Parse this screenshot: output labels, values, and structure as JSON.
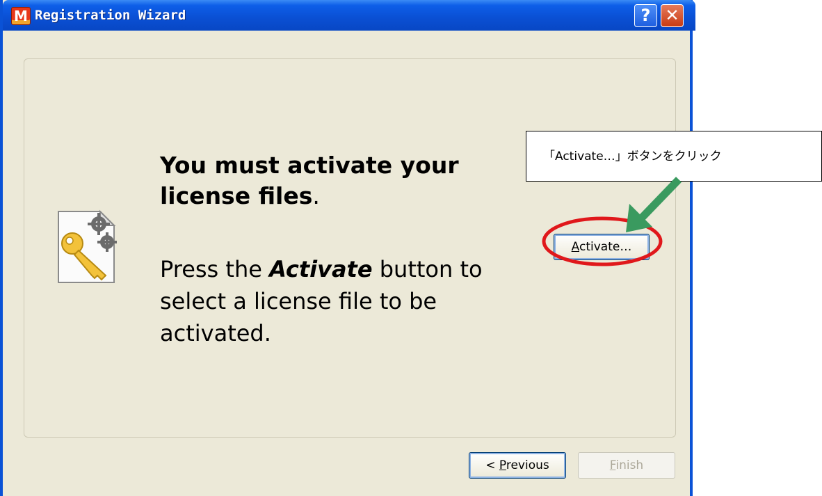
{
  "window": {
    "title": "Registration Wizard",
    "app_icon_letter": "M",
    "help_glyph": "?",
    "close_glyph": "✕"
  },
  "content": {
    "heading_line1": "You must activate your",
    "heading_line2": "license files",
    "heading_period": ".",
    "body_prefix": "Press the ",
    "body_emphasis": "Activate",
    "body_suffix_line1": " button to",
    "body_line2": "select a license file to be",
    "body_line3": "activated."
  },
  "buttons": {
    "activate_mnemonic": "A",
    "activate_rest": "ctivate…",
    "previous_prefix": "< ",
    "previous_mnemonic": "P",
    "previous_rest": "revious",
    "finish_mnemonic": "F",
    "finish_rest": "inish"
  },
  "annotation": {
    "callout_text": "「Activate…」ボタンをクリック",
    "highlight_color": "#e0181b",
    "arrow_color": "#3a9a5f"
  },
  "icons": {
    "app": "m-app-icon",
    "document": "license-key-document-icon"
  }
}
